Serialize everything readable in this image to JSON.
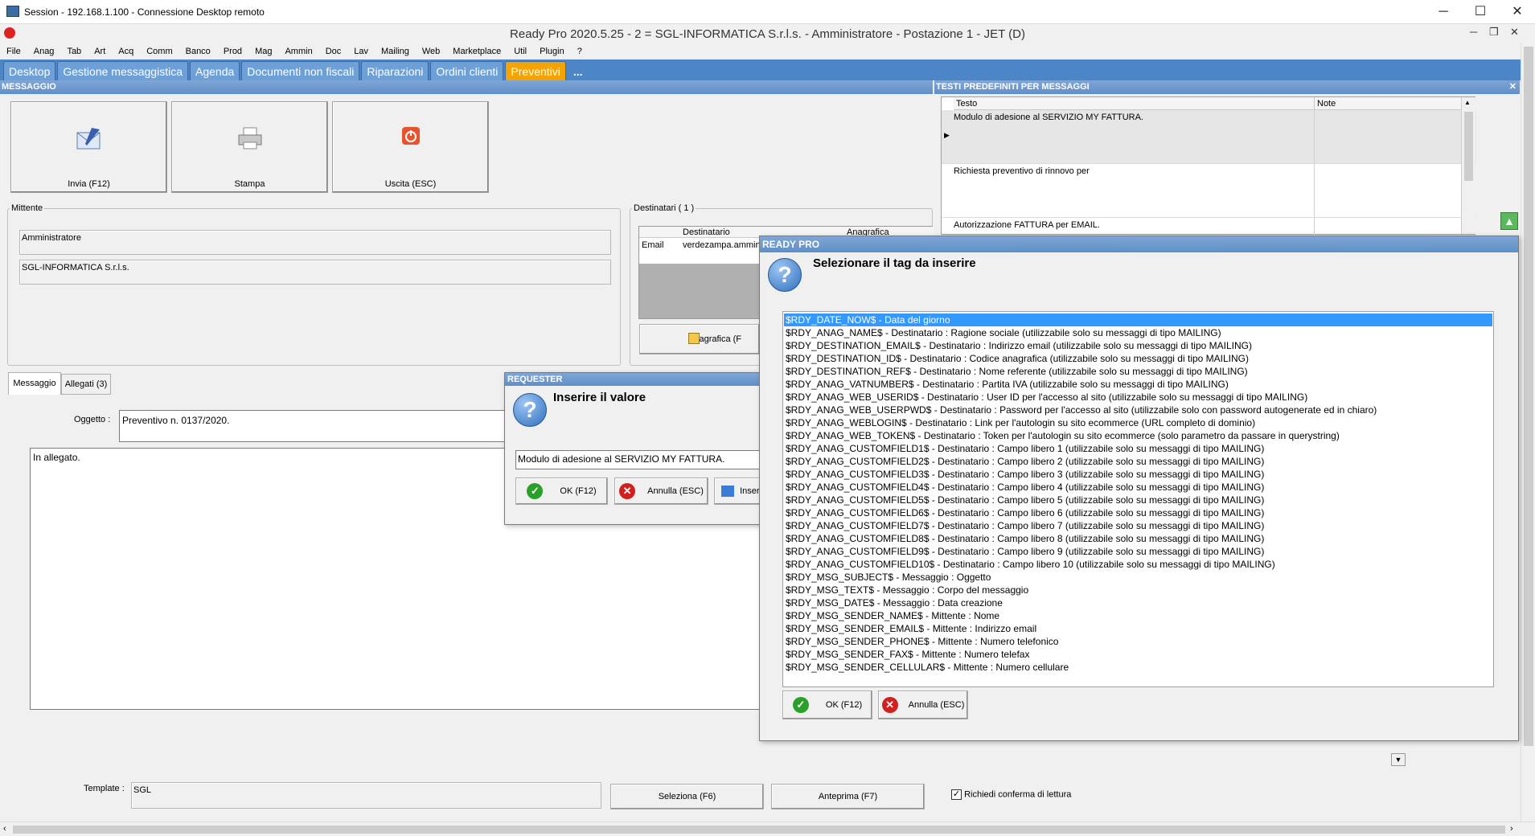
{
  "rdp": {
    "title": "Session - 192.168.1.100 - Connessione Desktop remoto",
    "minimize": "─",
    "maximize": "☐",
    "close": "✕"
  },
  "app": {
    "title": "Ready Pro 2020.5.25 - 2 = SGL-INFORMATICA S.r.l.s. - Amministratore - Postazione 1 - JET (D)",
    "minimize": "─",
    "restore": "❐",
    "close": "✕"
  },
  "menu": [
    "File",
    "Anag",
    "Tab",
    "Art",
    "Acq",
    "Comm",
    "Banco",
    "Prod",
    "Mag",
    "Ammin",
    "Doc",
    "Lav",
    "Mailing",
    "Web",
    "Marketplace",
    "Util",
    "Plugin",
    "?"
  ],
  "tabs": [
    "Desktop",
    "Gestione messaggistica",
    "Agenda",
    "Documenti non fiscali",
    "Riparazioni",
    "Ordini clienti",
    "Preventivi",
    "..."
  ],
  "message_panel": {
    "header": "MESSAGGIO",
    "buttons": {
      "send": "Invia (F12)",
      "print": "Stampa",
      "exit": "Uscita (ESC)"
    },
    "sender_legend": "Mittente",
    "sender_name": "Amministratore",
    "sender_company": "SGL-INFORMATICA S.r.l.s.",
    "recipients_legend": "Destinatari ( 1 )",
    "recipients_cols": [
      "Destinatario",
      "Anagrafica"
    ],
    "recipient_row": {
      "type": "Email",
      "address": "verdezampa.ammin"
    },
    "registry_button": "Anagrafica (F",
    "tab_message": "Messaggio",
    "tab_attachments": "Allegati (3)",
    "subject_label": "Oggetto :",
    "subject_value": "Preventivo n. 0137/2020.",
    "body": "In allegato.",
    "template_label": "Template :",
    "template_value": "SGL",
    "select_button": "Seleziona (F6)",
    "preview_button": "Anteprima (F7)",
    "read_receipt_label": "Richiedi conferma di lettura",
    "read_receipt_checked": true
  },
  "texts_panel": {
    "header": "TESTI PREDEFINITI PER MESSAGGI",
    "col_text": "Testo",
    "col_note": "Note",
    "rows": [
      "Modulo di adesione al SERVIZIO MY FATTURA.",
      "Richiesta preventivo di rinnovo per",
      "Autorizzazione FATTURA per EMAIL."
    ]
  },
  "requester": {
    "header": "REQUESTER",
    "title": "Inserire il valore",
    "value": "Modulo di adesione al SERVIZIO MY FATTURA.",
    "ok": "OK (F12)",
    "cancel": "Annulla (ESC)",
    "insert": "Inser"
  },
  "tag_dialog": {
    "header": "READY PRO",
    "title": "Selezionare il tag da inserire",
    "selected_index": 0,
    "items": [
      "$RDY_DATE_NOW$ - Data del giorno",
      "$RDY_ANAG_NAME$ - Destinatario : Ragione sociale (utilizzabile solo su messaggi di tipo MAILING)",
      "$RDY_DESTINATION_EMAIL$ - Destinatario : Indirizzo email (utilizzabile solo su messaggi di tipo MAILING)",
      "$RDY_DESTINATION_ID$ - Destinatario : Codice anagrafica (utilizzabile solo su messaggi di tipo MAILING)",
      "$RDY_DESTINATION_REF$ - Destinatario : Nome referente (utilizzabile solo su messaggi di tipo MAILING)",
      "$RDY_ANAG_VATNUMBER$ - Destinatario : Partita IVA (utilizzabile solo su messaggi di tipo MAILING)",
      "$RDY_ANAG_WEB_USERID$ - Destinatario : User ID per l'accesso al sito (utilizzabile solo su messaggi di tipo MAILING)",
      "$RDY_ANAG_WEB_USERPWD$ - Destinatario : Password per l'accesso al sito (utilizzabile solo con password autogenerate ed in chiaro)",
      "$RDY_ANAG_WEBLOGIN$ - Destinatario : Link per l'autologin su sito ecommerce (URL completo di dominio)",
      "$RDY_ANAG_WEB_TOKEN$ - Destinatario : Token per l'autologin su sito ecommerce (solo parametro da passare in querystring)",
      "$RDY_ANAG_CUSTOMFIELD1$ - Destinatario : Campo libero 1 (utilizzabile solo su messaggi di tipo MAILING)",
      "$RDY_ANAG_CUSTOMFIELD2$ - Destinatario : Campo libero 2 (utilizzabile solo su messaggi di tipo MAILING)",
      "$RDY_ANAG_CUSTOMFIELD3$ - Destinatario : Campo libero 3 (utilizzabile solo su messaggi di tipo MAILING)",
      "$RDY_ANAG_CUSTOMFIELD4$ - Destinatario : Campo libero 4 (utilizzabile solo su messaggi di tipo MAILING)",
      "$RDY_ANAG_CUSTOMFIELD5$ - Destinatario : Campo libero 5 (utilizzabile solo su messaggi di tipo MAILING)",
      "$RDY_ANAG_CUSTOMFIELD6$ - Destinatario : Campo libero 6 (utilizzabile solo su messaggi di tipo MAILING)",
      "$RDY_ANAG_CUSTOMFIELD7$ - Destinatario : Campo libero 7 (utilizzabile solo su messaggi di tipo MAILING)",
      "$RDY_ANAG_CUSTOMFIELD8$ - Destinatario : Campo libero 8 (utilizzabile solo su messaggi di tipo MAILING)",
      "$RDY_ANAG_CUSTOMFIELD9$ - Destinatario : Campo libero 9 (utilizzabile solo su messaggi di tipo MAILING)",
      "$RDY_ANAG_CUSTOMFIELD10$ - Destinatario : Campo libero 10 (utilizzabile solo su messaggi di tipo MAILING)",
      "$RDY_MSG_SUBJECT$ - Messaggio : Oggetto",
      "$RDY_MSG_TEXT$ - Messaggio : Corpo del messaggio",
      "$RDY_MSG_DATE$ - Messaggio : Data creazione",
      "$RDY_MSG_SENDER_NAME$ - Mittente : Nome",
      "$RDY_MSG_SENDER_EMAIL$ - Mittente : Indirizzo email",
      "$RDY_MSG_SENDER_PHONE$ - Mittente : Numero telefonico",
      "$RDY_MSG_SENDER_FAX$ - Mittente : Numero telefax",
      "$RDY_MSG_SENDER_CELLULAR$ - Mittente : Numero cellulare"
    ],
    "ok": "OK (F12)",
    "cancel": "Annulla (ESC)"
  },
  "colors": {
    "tab_bar": "#4d86c6",
    "active_tab": "#f5a300",
    "selection": "#3399ff",
    "panel_header": "#6f9bd0"
  }
}
